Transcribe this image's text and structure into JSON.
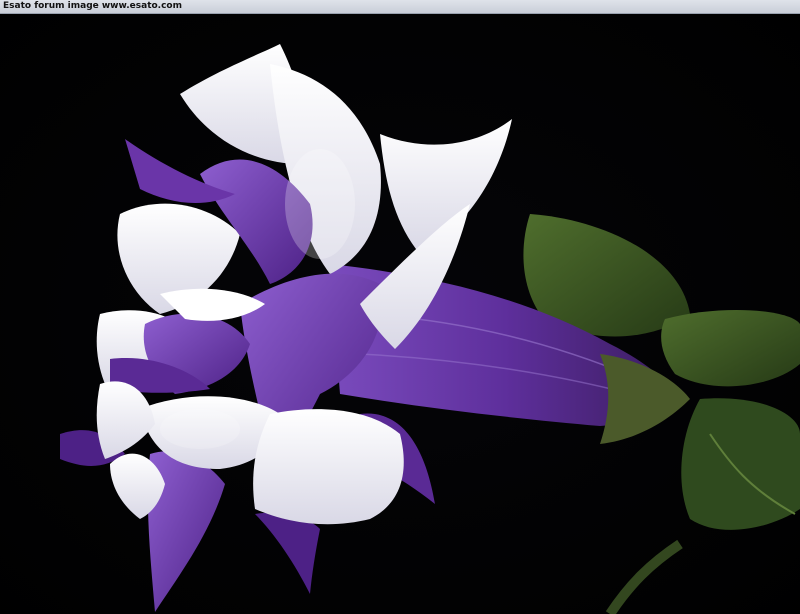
{
  "watermark": {
    "text": "Esato forum image www.esato.com"
  },
  "photo": {
    "subject": "datura-flower",
    "colors": {
      "background": "#000000",
      "petal_white": "#f2f2f6",
      "petal_purple": "#6a35a8",
      "purple_dark": "#4a1f80",
      "leaf_green": "#3e5a26"
    }
  }
}
